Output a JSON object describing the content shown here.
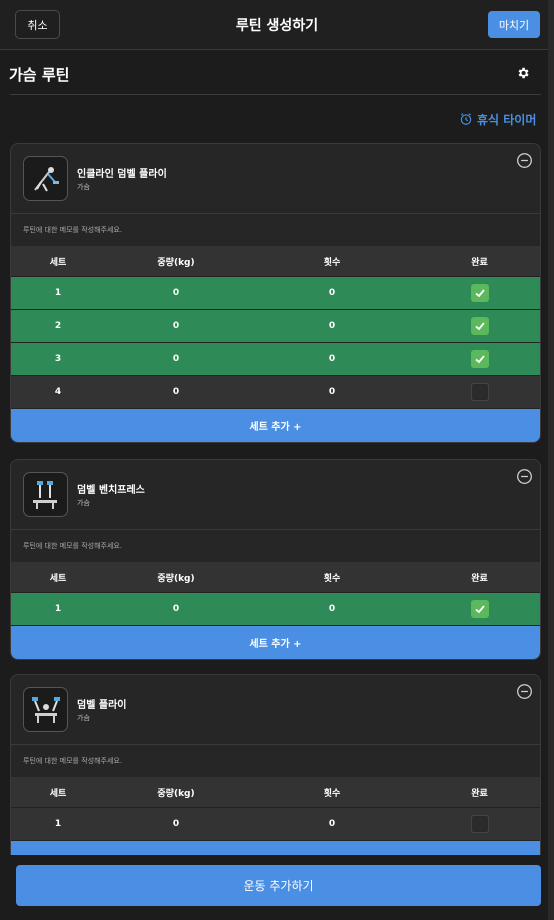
{
  "topbar": {
    "cancel_label": "취소",
    "title": "루틴 생성하기",
    "finish_label": "마치기"
  },
  "routine": {
    "title": "가슴 루틴",
    "rest_timer_label": "휴식 타이머"
  },
  "table_headers": {
    "set": "세트",
    "weight": "중량(kg)",
    "reps": "횟수",
    "done": "완료"
  },
  "memo_placeholder": "루틴에 대한 메모를 작성해주세요.",
  "add_set_label": "세트 추가 +",
  "exercises": [
    {
      "name": "인클라인 덤벨 플라이",
      "category": "가슴",
      "sets": [
        {
          "set": "1",
          "weight": "0",
          "reps": "0",
          "done": true
        },
        {
          "set": "2",
          "weight": "0",
          "reps": "0",
          "done": true
        },
        {
          "set": "3",
          "weight": "0",
          "reps": "0",
          "done": true
        },
        {
          "set": "4",
          "weight": "0",
          "reps": "0",
          "done": false
        }
      ]
    },
    {
      "name": "덤벨 벤치프레스",
      "category": "가슴",
      "sets": [
        {
          "set": "1",
          "weight": "0",
          "reps": "0",
          "done": true
        }
      ]
    },
    {
      "name": "덤벨 플라이",
      "category": "가슴",
      "sets": [
        {
          "set": "1",
          "weight": "0",
          "reps": "0",
          "done": false
        }
      ]
    }
  ],
  "bottom": {
    "add_exercise_label": "운동 추가하기"
  },
  "colors": {
    "accent": "#4a8fe3",
    "done_row": "#2e8b57",
    "check": "#5cb85c",
    "background": "#1c1c1c"
  }
}
